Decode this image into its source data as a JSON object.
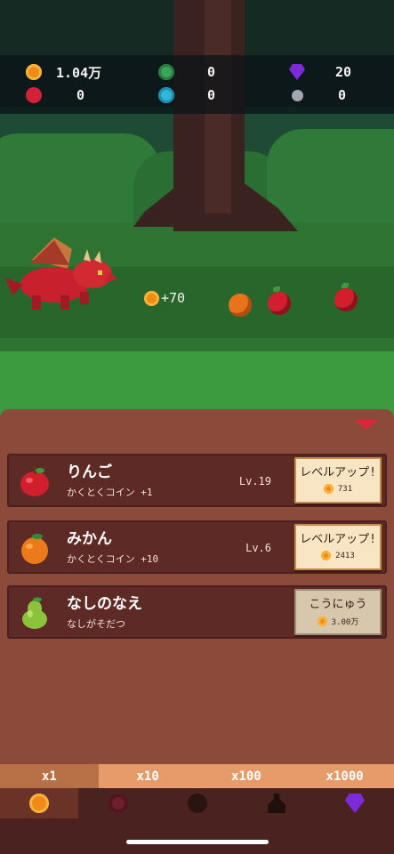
{
  "stats": {
    "coins": "1.04万",
    "green_orbs": "0",
    "gems": "20",
    "rubies": "0",
    "blue_orbs": "0",
    "stones": "0"
  },
  "scene": {
    "float_text": "+70"
  },
  "items": [
    {
      "name": "りんご",
      "desc": "かくとくコイン +1",
      "level": "Lv.19",
      "action_label": "レベルアップ!",
      "price": "731",
      "icon": "apple-icon"
    },
    {
      "name": "みかん",
      "desc": "かくとくコイン +10",
      "level": "Lv.6",
      "action_label": "レベルアップ!",
      "price": "2413",
      "icon": "orange-icon"
    },
    {
      "name": "なしのなえ",
      "desc": "なしがそだつ",
      "level": "",
      "action_label": "こうにゅう",
      "price": "3.00万",
      "icon": "pear-icon"
    }
  ],
  "multipliers": [
    "x1",
    "x10",
    "x100",
    "x1000"
  ],
  "active_multiplier": "x1",
  "nav": [
    "coin-icon",
    "ruby-icon",
    "dark-orb-icon",
    "bottle-icon",
    "gem-icon"
  ],
  "colors": {
    "panel": "#8c4a3b",
    "card": "#5e2a26",
    "accent_red": "#d8283a",
    "coin": "#f08a17"
  }
}
